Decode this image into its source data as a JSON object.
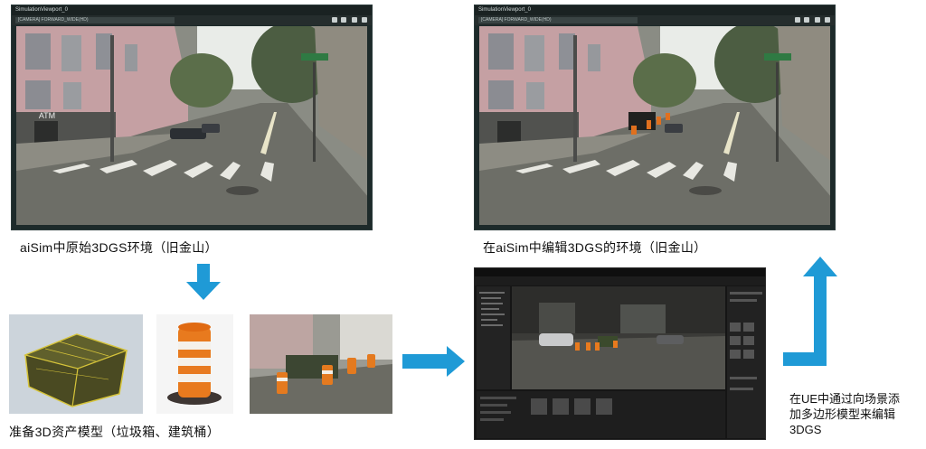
{
  "viewport_left": {
    "title": "SimulationViewport_0",
    "dropdown": "[CAMERA] FORWARD_WIDE(HD)"
  },
  "viewport_right": {
    "title": "SimulationViewport_0",
    "dropdown": "[CAMERA] FORWARD_WIDE(HD)"
  },
  "captions": {
    "original_env": "aiSim中原始3DGS环境（旧金山）",
    "edited_env": "在aiSim中编辑3DGS的环境（旧金山）",
    "assets": "准备3D资产模型（垃圾箱、建筑桶）",
    "ue_note": "在UE中通过向场景添\n加多边形模型来编辑\n3DGS"
  },
  "scene": {
    "atm_sign": "ATM"
  },
  "colors": {
    "arrow": "#1f9ad6",
    "window_frame": "#1d2a2a"
  }
}
